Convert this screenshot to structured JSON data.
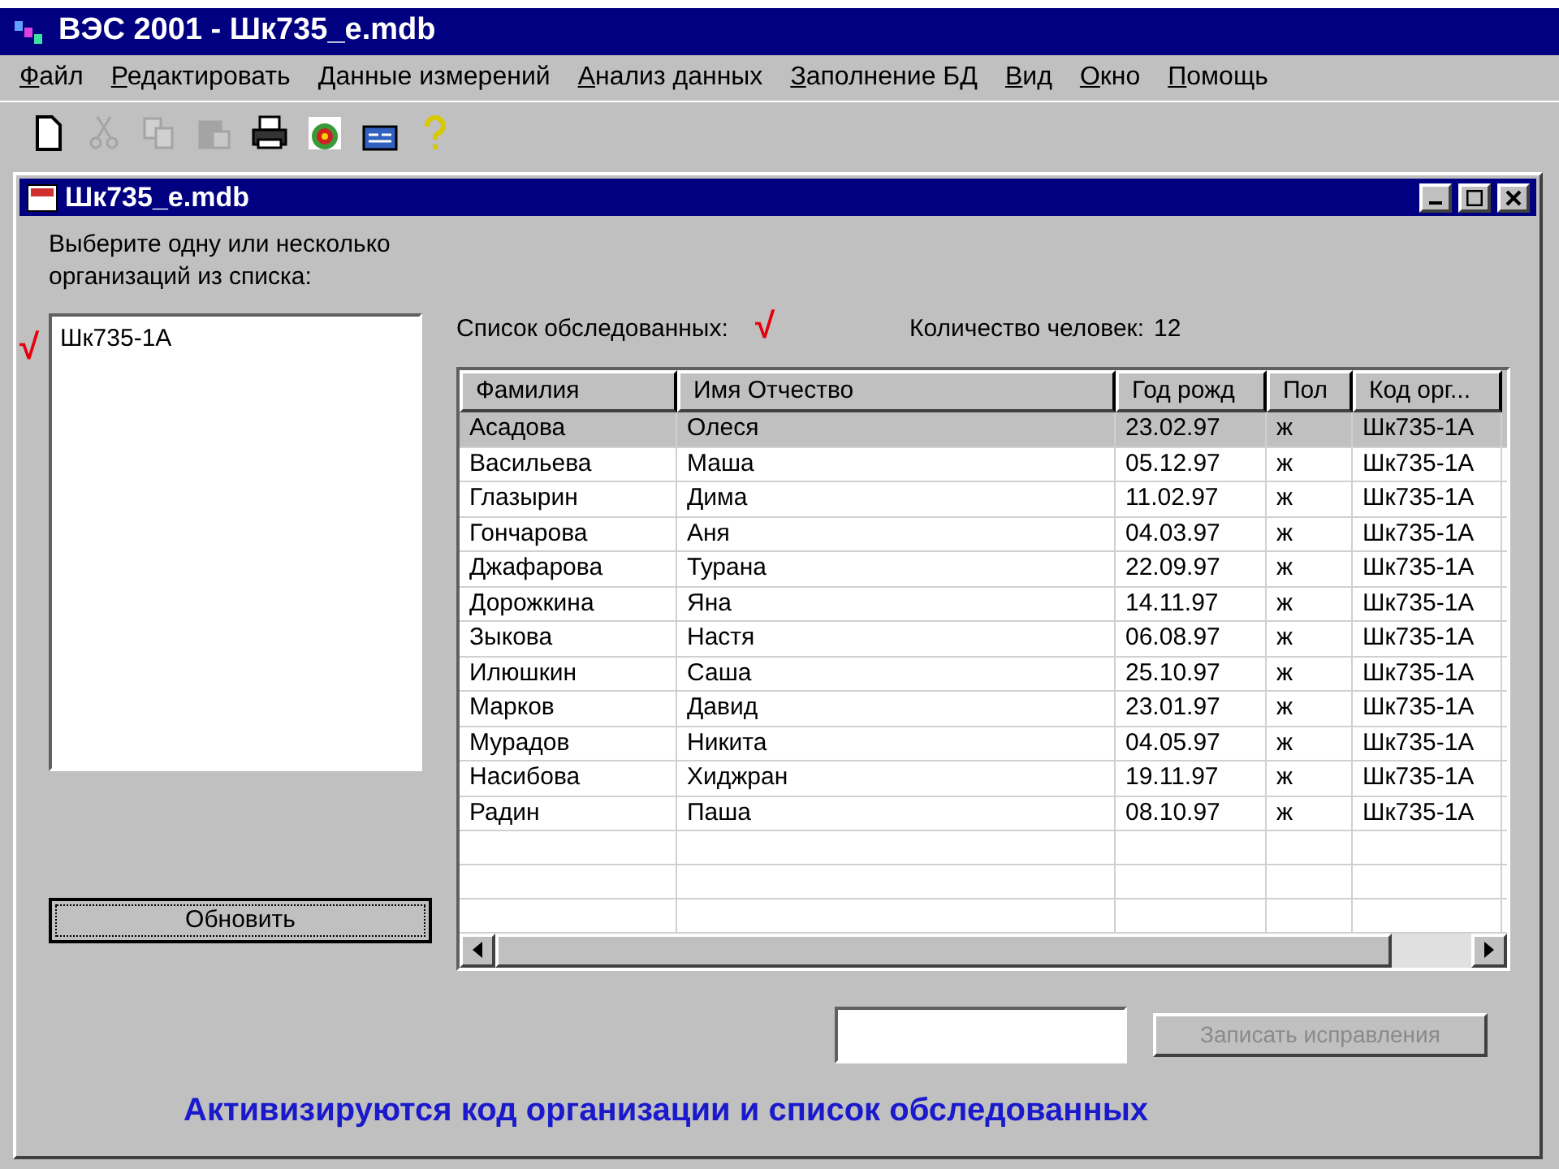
{
  "app_window": {
    "title": "ВЭС 2001 - Шк735_е.mdb"
  },
  "menu": [
    "Файл",
    "Редактировать",
    "Данные измерений",
    "Анализ данных",
    "Заполнение БД",
    "Вид",
    "Окно",
    "Помощь"
  ],
  "toolbar": [
    {
      "kind": "new",
      "disabled": false
    },
    {
      "kind": "cut",
      "disabled": true
    },
    {
      "kind": "copy",
      "disabled": true
    },
    {
      "kind": "paste",
      "disabled": true
    },
    {
      "kind": "print",
      "disabled": false
    },
    {
      "kind": "target",
      "disabled": false
    },
    {
      "kind": "database",
      "disabled": false
    },
    {
      "kind": "help",
      "disabled": false
    }
  ],
  "child_window": {
    "title": "Шк735_е.mdb"
  },
  "org_prompt": "Выберите одну или несколько организаций из списка:",
  "org_list": [
    {
      "label": "Шк735-1А",
      "selected": false
    }
  ],
  "org_mark": "√",
  "refresh_button": "Обновить",
  "list_label": "Список обследованных:",
  "list_mark": "√",
  "count_label": "Количество человек:",
  "count": "12",
  "table": {
    "columns": [
      "Фамилия",
      "Имя Отчество",
      "Год рожд",
      "Пол",
      "Код орг..."
    ],
    "rows": [
      {
        "cells": [
          "Асадова",
          "Олеся",
          "23.02.97",
          "ж",
          "Шк735-1А"
        ],
        "selected": true
      },
      {
        "cells": [
          "Васильева",
          "Маша",
          "05.12.97",
          "ж",
          "Шк735-1А"
        ],
        "selected": false
      },
      {
        "cells": [
          "Глазырин",
          "Дима",
          "11.02.97",
          "ж",
          "Шк735-1А"
        ],
        "selected": false
      },
      {
        "cells": [
          "Гончарова",
          "Аня",
          "04.03.97",
          "ж",
          "Шк735-1А"
        ],
        "selected": false
      },
      {
        "cells": [
          "Джафарова",
          "Турана",
          "22.09.97",
          "ж",
          "Шк735-1А"
        ],
        "selected": false
      },
      {
        "cells": [
          "Дорожкина",
          "Яна",
          "14.11.97",
          "ж",
          "Шк735-1А"
        ],
        "selected": false
      },
      {
        "cells": [
          "Зыкова",
          "Настя",
          "06.08.97",
          "ж",
          "Шк735-1А"
        ],
        "selected": false
      },
      {
        "cells": [
          "Илюшкин",
          "Саша",
          "25.10.97",
          "ж",
          "Шк735-1А"
        ],
        "selected": false
      },
      {
        "cells": [
          "Марков",
          "Давид",
          "23.01.97",
          "ж",
          "Шк735-1А"
        ],
        "selected": false
      },
      {
        "cells": [
          "Мурадов",
          "Никита",
          "04.05.97",
          "ж",
          "Шк735-1А"
        ],
        "selected": false
      },
      {
        "cells": [
          "Насибова",
          "Хиджран",
          "19.11.97",
          "ж",
          "Шк735-1А"
        ],
        "selected": false
      },
      {
        "cells": [
          "Радин",
          "Паша",
          "08.10.97",
          "ж",
          "Шк735-1А"
        ],
        "selected": false
      }
    ]
  },
  "save_button": {
    "label": "Записать исправления",
    "disabled": true
  },
  "caption": "Активизируются код организации и список обследованных"
}
